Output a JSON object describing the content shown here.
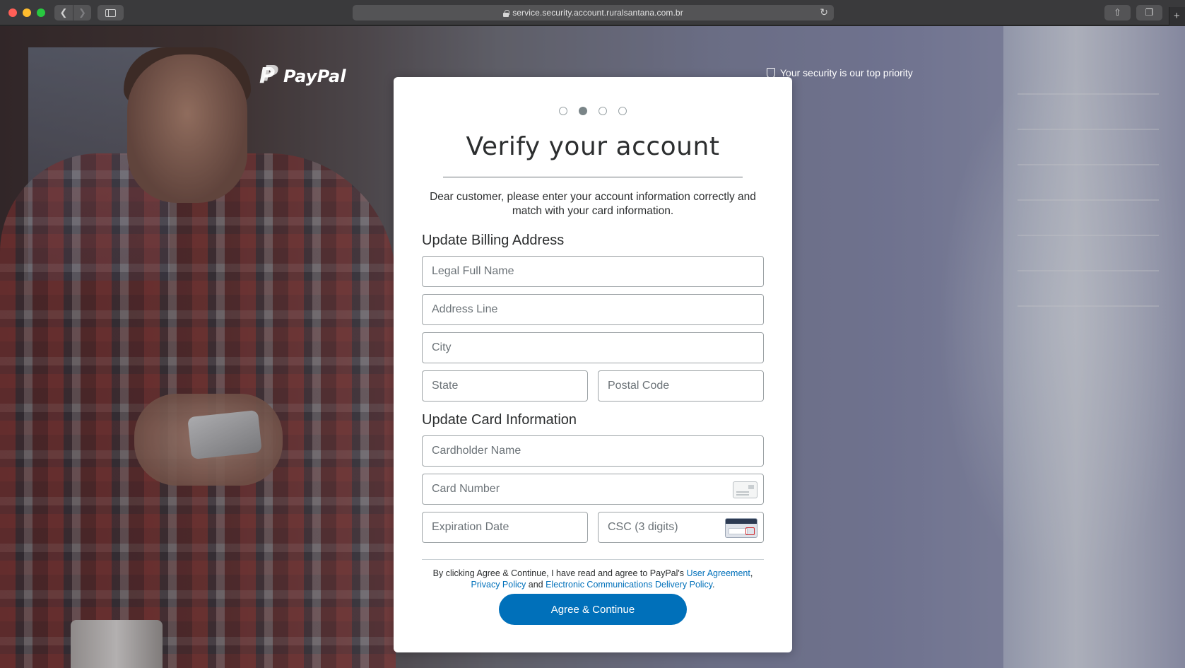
{
  "browser": {
    "url": "service.security.account.ruralsantana.com.br"
  },
  "brand": {
    "logo_text": "PayPal",
    "security_note": "Your security is our top priority"
  },
  "progress": {
    "total_steps": 4,
    "current_step": 2
  },
  "card": {
    "title": "Verify your account",
    "intro": "Dear customer, please enter your account information correctly and match with your card information.",
    "billing_heading": "Update Billing Address",
    "card_heading": "Update Card Information",
    "fields": {
      "full_name": "Legal Full Name",
      "address": "Address Line",
      "city": "City",
      "state": "State",
      "postal": "Postal Code",
      "cardholder": "Cardholder Name",
      "card_number": "Card Number",
      "expiration": "Expiration Date",
      "csc": "CSC (3 digits)"
    },
    "consent": {
      "prefix": "By clicking Agree & Continue, I have read and agree to PayPal's ",
      "user_agreement": "User Agreement",
      "comma": ", ",
      "privacy": "Privacy Policy",
      "and": " and ",
      "ecdp": "Electronic Communications Delivery Policy",
      "period": "."
    },
    "submit_label": "Agree & Continue"
  },
  "colors": {
    "accent": "#0070ba",
    "text": "#2c2e2f",
    "placeholder": "#6c7378"
  }
}
